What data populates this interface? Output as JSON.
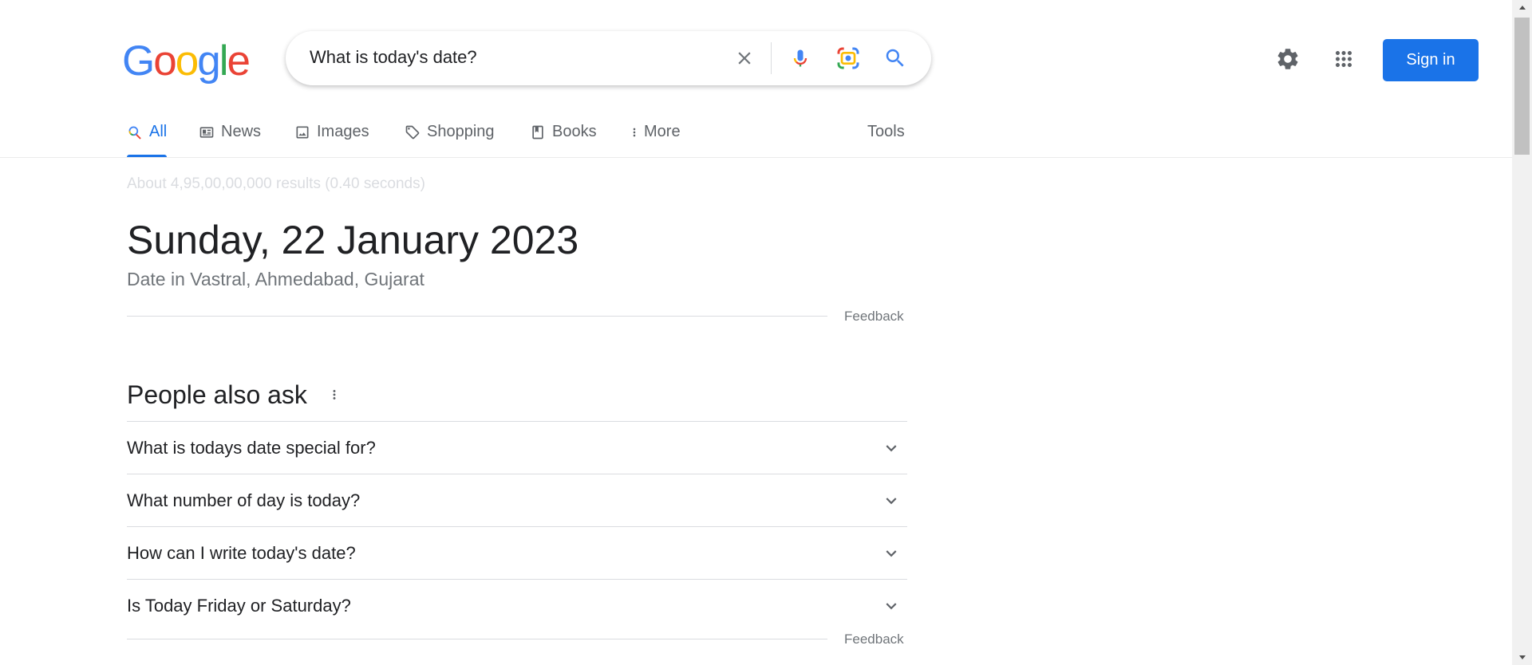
{
  "logo": {
    "letters": [
      "G",
      "o",
      "o",
      "g",
      "l",
      "e"
    ],
    "colors": [
      "#4285F4",
      "#EA4335",
      "#FBBC05",
      "#4285F4",
      "#34A853",
      "#EA4335"
    ]
  },
  "search": {
    "query": "What is today's date?"
  },
  "header": {
    "signin_label": "Sign in"
  },
  "tabs": [
    {
      "label": "All",
      "icon": "search-icon",
      "active": true
    },
    {
      "label": "News",
      "icon": "news-icon"
    },
    {
      "label": "Images",
      "icon": "image-icon"
    },
    {
      "label": "Shopping",
      "icon": "tag-icon"
    },
    {
      "label": "Books",
      "icon": "book-icon"
    },
    {
      "label": "More",
      "icon": "more-vertical-icon"
    },
    {
      "label": "Tools"
    }
  ],
  "results": {
    "stats": "About 4,95,00,00,000 results (0.40 seconds)"
  },
  "date_card": {
    "date": "Sunday, 22 January 2023",
    "location": "Date in Vastral, Ahmedabad, Gujarat",
    "feedback": "Feedback"
  },
  "paa": {
    "title": "People also ask",
    "questions": [
      "What is todays date special for?",
      "What number of day is today?",
      "How can I write today's date?",
      "Is Today Friday or Saturday?"
    ],
    "feedback": "Feedback"
  },
  "colors": {
    "accent": "#1a73e8",
    "text": "#202124",
    "muted": "#70757a"
  }
}
